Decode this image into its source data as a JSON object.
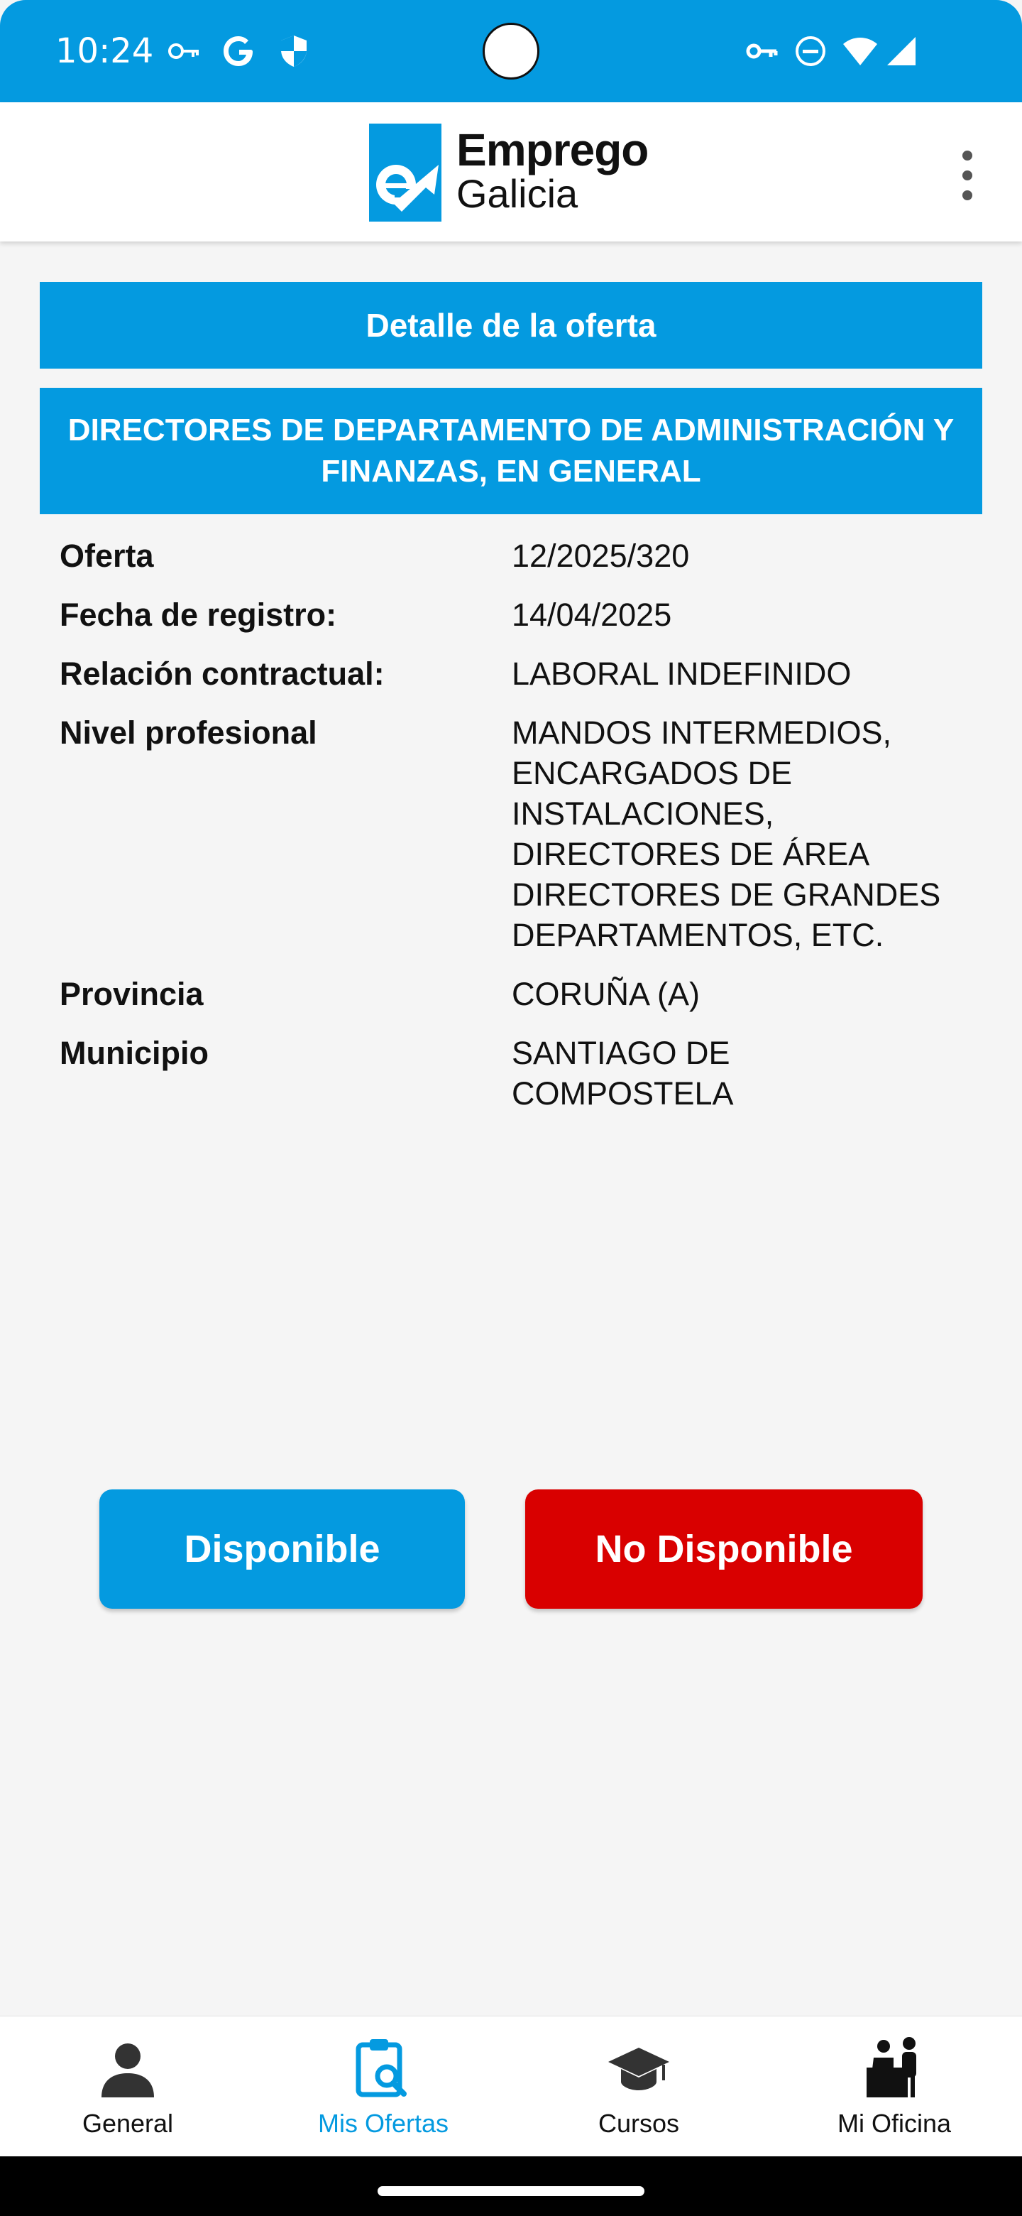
{
  "status_bar": {
    "time": "10:24",
    "left_icons": [
      "key-icon",
      "google-icon",
      "shield-icon"
    ],
    "right_icons": [
      "vpn-key-icon",
      "do-not-disturb-icon",
      "wifi-icon",
      "cell-signal-icon"
    ]
  },
  "app_bar": {
    "logo_line1": "Emprego",
    "logo_line2": "Galicia",
    "menu_icon": "more-vert-icon"
  },
  "page": {
    "title": "Detalle de la oferta",
    "job_title": "DIRECTORES DE DEPARTAMENTO DE ADMINISTRACIÓN Y FINANZAS, EN GENERAL"
  },
  "details": [
    {
      "label": "Oferta",
      "value": "12/2025/320"
    },
    {
      "label": "Fecha de registro:",
      "value": "14/04/2025"
    },
    {
      "label": "Relación contractual:",
      "value": "LABORAL INDEFINIDO"
    },
    {
      "label": "Nivel profesional",
      "value": "MANDOS INTERMEDIOS,\nENCARGADOS DE\nINSTALACIONES,\nDIRECTORES DE ÁREA\nDIRECTORES DE GRANDES\nDEPARTAMENTOS, ETC."
    },
    {
      "label": "Provincia",
      "value": "CORUÑA (A)"
    },
    {
      "label": "Municipio",
      "value": "SANTIAGO DE\nCOMPOSTELA"
    }
  ],
  "actions": {
    "available": "Disponible",
    "not_available": "No Disponible"
  },
  "bottom_nav": [
    {
      "label": "General",
      "icon": "person-icon",
      "active": false
    },
    {
      "label": "Mis Ofertas",
      "icon": "clipboard-search-icon",
      "active": true
    },
    {
      "label": "Cursos",
      "icon": "graduation-cap-icon",
      "active": false
    },
    {
      "label": "Mi Oficina",
      "icon": "office-desk-icon",
      "active": false
    }
  ],
  "colors": {
    "primary": "#049ae0",
    "danger": "#d90000",
    "background": "#f5f5f5"
  }
}
